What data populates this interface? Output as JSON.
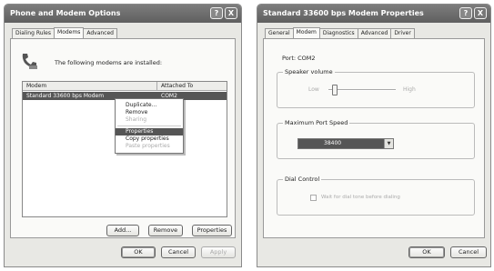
{
  "window1": {
    "title": "Phone and Modem Options",
    "title_buttons": {
      "help": "?",
      "close": "X"
    },
    "tabs": [
      "Dialing Rules",
      "Modems",
      "Advanced"
    ],
    "info_text": "The following modems are installed:",
    "list_headers": [
      "Modem",
      "Attached To"
    ],
    "rows": [
      {
        "modem": "Standard 33600 bps Modem",
        "attached": "COM2"
      }
    ],
    "context_menu": [
      {
        "label": "Duplicate...",
        "disabled": false
      },
      {
        "label": "Remove",
        "disabled": false
      },
      {
        "label": "Sharing",
        "disabled": true
      },
      {
        "label": "Properties",
        "disabled": false
      },
      {
        "label": "Copy properties",
        "disabled": false
      },
      {
        "label": "Paste properties",
        "disabled": true
      }
    ],
    "buttons": {
      "add": "Add...",
      "remove": "Remove",
      "properties": "Properties"
    },
    "footer": {
      "ok": "OK",
      "cancel": "Cancel",
      "apply": "Apply"
    }
  },
  "window2": {
    "title": "Standard 33600 bps Modem Properties",
    "title_buttons": {
      "help": "?",
      "close": "X"
    },
    "tabs": [
      "General",
      "Modem",
      "Diagnostics",
      "Advanced",
      "Driver"
    ],
    "port_label": "Port:  COM2",
    "speaker_volume": {
      "label": "Speaker volume",
      "low": "Low",
      "high": "High",
      "level": 0.1
    },
    "max_port_speed": {
      "label": "Maximum Port Speed",
      "value": "38400"
    },
    "dial_control": {
      "label": "Dial Control",
      "checkbox_label": "Wait for dial tone before dialing"
    },
    "footer": {
      "ok": "OK",
      "cancel": "Cancel"
    }
  }
}
